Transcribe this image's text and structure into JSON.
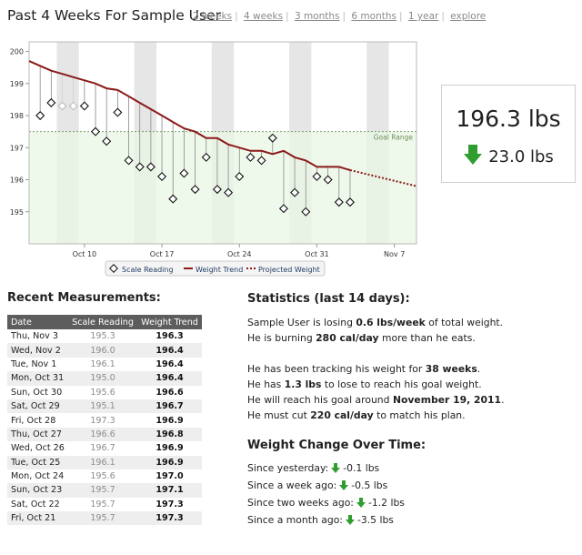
{
  "page": {
    "title": "Past 4 Weeks For Sample User",
    "nav": [
      "2 weeks",
      "4 weeks",
      "3 months",
      "6 months",
      "1 year",
      "explore"
    ]
  },
  "summary": {
    "weight": "196.3 lbs",
    "change": "23.0 lbs",
    "change_icon": "down-arrow-green",
    "color": "#2f9e2f"
  },
  "chart_data": {
    "type": "line",
    "title": "",
    "xlabel": "",
    "ylabel": "",
    "ylim": [
      194,
      200.3
    ],
    "y_ticks": [
      "195",
      "196",
      "197",
      "198",
      "199",
      "200"
    ],
    "x_ticks": [
      "Oct 10",
      "Oct 17",
      "Oct 24",
      "Oct 31",
      "Nov 7"
    ],
    "xlim": [
      "Oct 5",
      "Nov 9"
    ],
    "grid": false,
    "weekend_shading": true,
    "goal_range": {
      "label": "Goal Range",
      "ymin": 194,
      "ymax": 197.5
    },
    "colors": {
      "trend": "#8b1a1a",
      "goal_fill": "#eaf7e4",
      "goal_line": "#7a9f6a",
      "weekend": "#e6e6e6"
    },
    "series": [
      {
        "name": "Scale Reading",
        "x": [
          "Oct 6",
          "Oct 7",
          "Oct 8",
          "Oct 9",
          "Oct 10",
          "Oct 11",
          "Oct 12",
          "Oct 13",
          "Oct 14",
          "Oct 15",
          "Oct 16",
          "Oct 17",
          "Oct 18",
          "Oct 19",
          "Oct 20",
          "Oct 21",
          "Oct 22",
          "Oct 23",
          "Oct 24",
          "Oct 25",
          "Oct 26",
          "Oct 27",
          "Oct 28",
          "Oct 29",
          "Oct 30",
          "Oct 31",
          "Nov 1",
          "Nov 2",
          "Nov 3"
        ],
        "y": [
          198.0,
          198.4,
          198.3,
          198.3,
          198.3,
          197.5,
          197.2,
          198.1,
          196.6,
          196.4,
          196.4,
          196.1,
          195.4,
          196.2,
          195.7,
          196.7,
          195.7,
          195.6,
          196.1,
          196.7,
          196.6,
          197.3,
          195.1,
          195.6,
          195.0,
          196.1,
          196.0,
          195.3,
          195.3
        ],
        "faded": [
          2,
          3
        ]
      },
      {
        "name": "Weight Trend",
        "x": [
          "Oct 5",
          "Oct 6",
          "Oct 7",
          "Oct 8",
          "Oct 9",
          "Oct 10",
          "Oct 11",
          "Oct 12",
          "Oct 13",
          "Oct 14",
          "Oct 15",
          "Oct 16",
          "Oct 17",
          "Oct 18",
          "Oct 19",
          "Oct 20",
          "Oct 21",
          "Oct 22",
          "Oct 23",
          "Oct 24",
          "Oct 25",
          "Oct 26",
          "Oct 27",
          "Oct 28",
          "Oct 29",
          "Oct 30",
          "Oct 31",
          "Nov 1",
          "Nov 2",
          "Nov 3"
        ],
        "y": [
          199.7,
          199.55,
          199.4,
          199.3,
          199.2,
          199.1,
          199.0,
          198.85,
          198.8,
          198.6,
          198.4,
          198.2,
          198.0,
          197.8,
          197.6,
          197.5,
          197.3,
          197.3,
          197.1,
          197.0,
          196.9,
          196.9,
          196.8,
          196.9,
          196.7,
          196.6,
          196.4,
          196.4,
          196.4,
          196.3
        ]
      },
      {
        "name": "Projected Weight",
        "x": [
          "Nov 3",
          "Nov 9"
        ],
        "y": [
          196.3,
          195.8
        ]
      }
    ]
  },
  "recent": {
    "title": "Recent Measurements:",
    "headers": [
      "Date",
      "Scale Reading",
      "Weight Trend"
    ],
    "rows": [
      [
        "Thu, Nov 3",
        "195.3",
        "196.3"
      ],
      [
        "Wed, Nov 2",
        "196.0",
        "196.4"
      ],
      [
        "Tue, Nov 1",
        "196.1",
        "196.4"
      ],
      [
        "Mon, Oct 31",
        "195.0",
        "196.4"
      ],
      [
        "Sun, Oct 30",
        "195.6",
        "196.6"
      ],
      [
        "Sat, Oct 29",
        "195.1",
        "196.7"
      ],
      [
        "Fri, Oct 28",
        "197.3",
        "196.9"
      ],
      [
        "Thu, Oct 27",
        "196.6",
        "196.8"
      ],
      [
        "Wed, Oct 26",
        "196.7",
        "196.9"
      ],
      [
        "Tue, Oct 25",
        "196.1",
        "196.9"
      ],
      [
        "Mon, Oct 24",
        "195.6",
        "197.0"
      ],
      [
        "Sun, Oct 23",
        "195.7",
        "197.1"
      ],
      [
        "Sat, Oct 22",
        "195.7",
        "197.3"
      ],
      [
        "Fri, Oct 21",
        "195.7",
        "197.3"
      ]
    ]
  },
  "stats": {
    "title": "Statistics (last 14 days):",
    "line1_pre": "Sample User is losing ",
    "line1_bold": "0.6 lbs/week",
    "line1_post": " of total weight.",
    "line2_pre": "He is burning ",
    "line2_bold": "280 cal/day",
    "line2_post": " more than he eats.",
    "line3_pre": "He has been tracking his weight for ",
    "line3_bold": "38 weeks",
    "line3_post": ".",
    "line4_pre": "He has ",
    "line4_bold": "1.3 lbs",
    "line4_post": " to lose to reach his goal weight.",
    "line5_pre": "He will reach his goal around ",
    "line5_bold": "November 19, 2011",
    "line5_post": ".",
    "line6_pre": "He must cut ",
    "line6_bold": "220 cal/day",
    "line6_post": " to match his plan."
  },
  "changes": {
    "title": "Weight Change Over Time:",
    "rows": [
      {
        "label": "Since yesterday:",
        "value": "-0.1 lbs"
      },
      {
        "label": "Since a week ago:",
        "value": "-0.5 lbs"
      },
      {
        "label": "Since two weeks ago:",
        "value": "-1.2 lbs"
      },
      {
        "label": "Since a month ago:",
        "value": "-3.5 lbs"
      }
    ],
    "arrow_icon": "down-arrow-green"
  }
}
